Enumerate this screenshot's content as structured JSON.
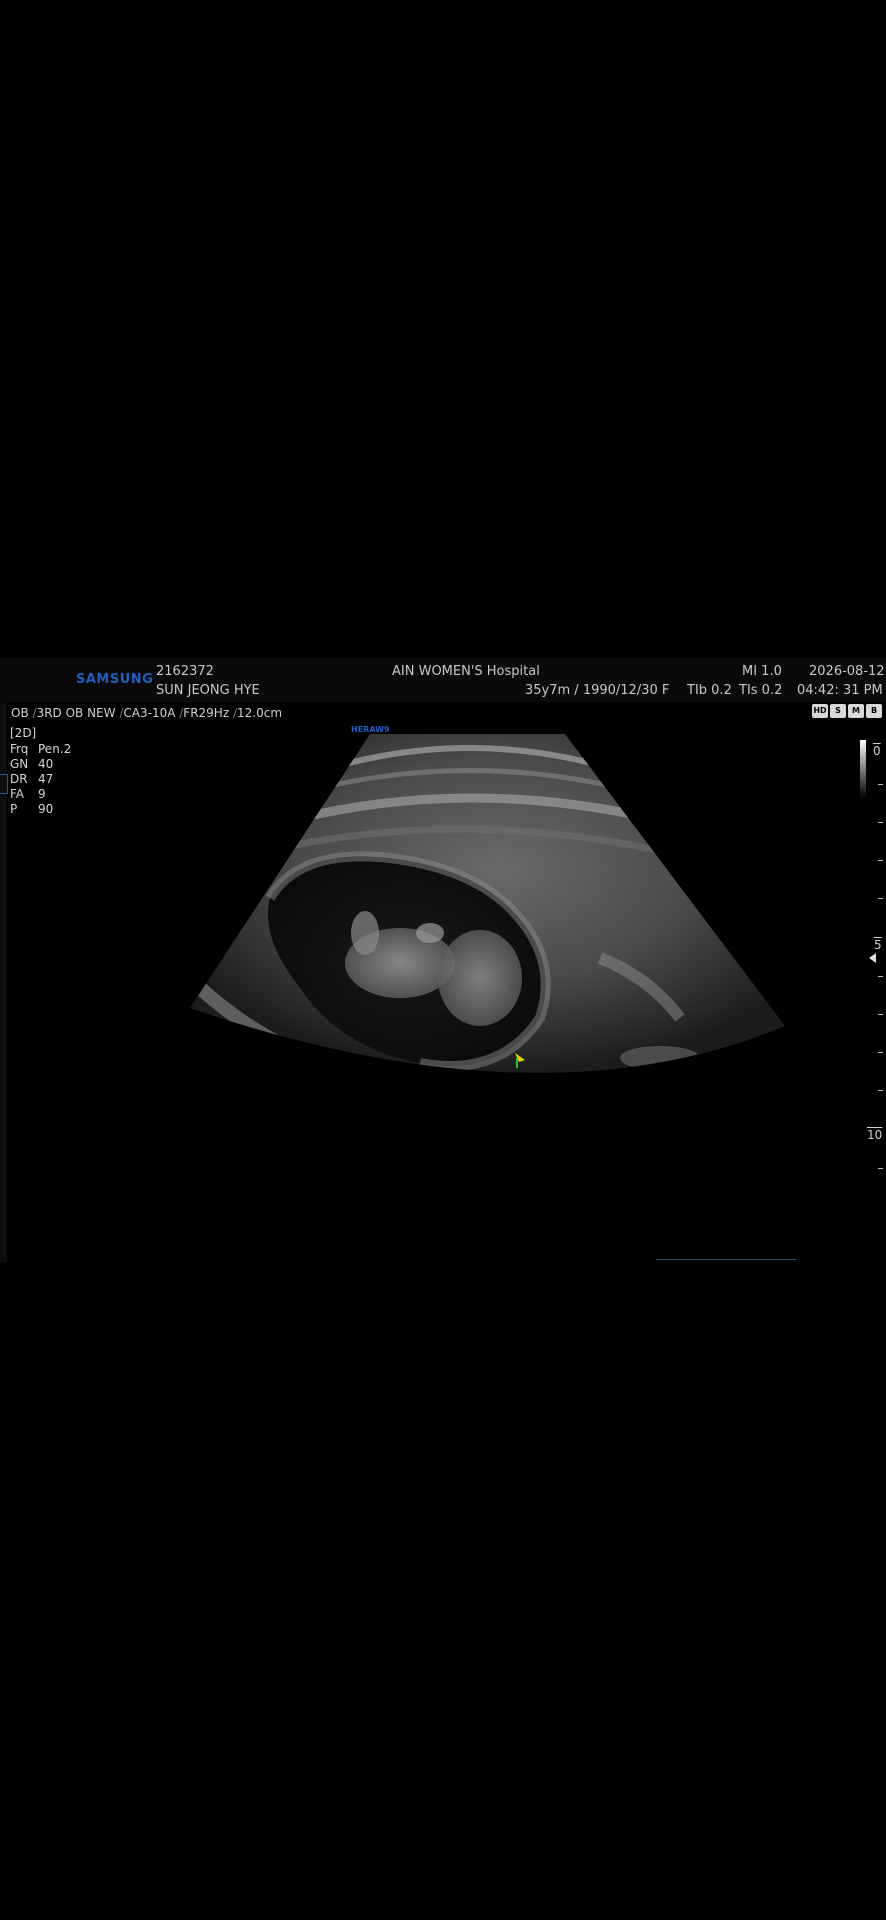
{
  "header": {
    "brand": "SAMSUNG",
    "patient_id": "2162372",
    "patient_name": "SUN JEONG HYE",
    "hospital": "AIN WOMEN'S Hospital",
    "patient_info": "35y7m / 1990/12/30   F",
    "mi": "MI  1.0",
    "tib": "TIb 0.2",
    "tis": "TIs 0.2",
    "date": "2026-08-12",
    "time": "04:42: 31 PM"
  },
  "preset": {
    "app": "OB",
    "preset": "3RD OB NEW",
    "probe": "CA3-10A",
    "frame_rate": "FR29Hz",
    "depth": "12.0cm"
  },
  "params": {
    "mode": "[2D]",
    "rows": [
      {
        "key": "Frq",
        "value": "Pen.2"
      },
      {
        "key": "GN",
        "value": "40"
      },
      {
        "key": "DR",
        "value": "47"
      },
      {
        "key": "FA",
        "value": "9"
      },
      {
        "key": "P",
        "value": "90"
      }
    ]
  },
  "system_label": "HERAW9",
  "mode_icons": [
    "HD",
    "S",
    "M",
    "B"
  ],
  "depth_scale": {
    "labels": [
      "0",
      "5",
      "10"
    ]
  },
  "colors": {
    "brand_blue": "#1f5fbf",
    "background": "#000000",
    "text": "#c8c8c8"
  }
}
